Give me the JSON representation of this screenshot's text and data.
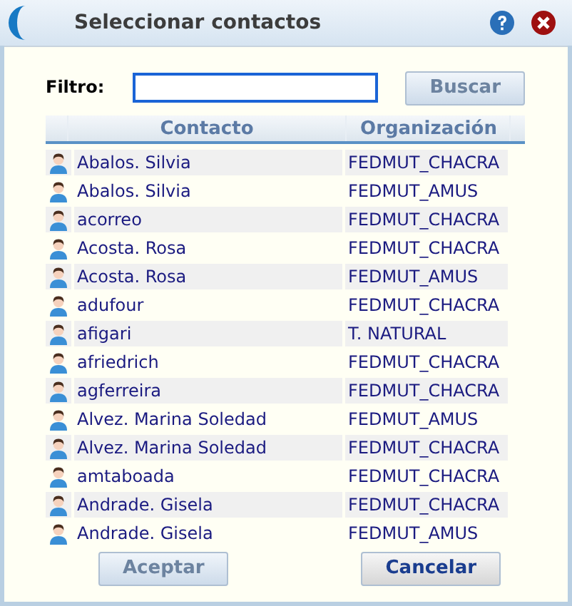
{
  "window": {
    "title": "Seleccionar contactos"
  },
  "filter": {
    "label": "Filtro:",
    "button": {
      "label": "Buscar",
      "disabled": true
    }
  },
  "table": {
    "columns": [
      "Contacto",
      "Organización"
    ],
    "rows": [
      {
        "contact": "Abalos. Silvia",
        "organization": "FEDMUT_CHACRA"
      },
      {
        "contact": "Abalos. Silvia",
        "organization": "FEDMUT_AMUS"
      },
      {
        "contact": "acorreo",
        "organization": "FEDMUT_CHACRA"
      },
      {
        "contact": "Acosta. Rosa",
        "organization": "FEDMUT_CHACRA"
      },
      {
        "contact": "Acosta. Rosa",
        "organization": "FEDMUT_AMUS"
      },
      {
        "contact": "adufour",
        "organization": "FEDMUT_CHACRA"
      },
      {
        "contact": "afigari",
        "organization": "T. NATURAL"
      },
      {
        "contact": "afriedrich",
        "organization": "FEDMUT_CHACRA"
      },
      {
        "contact": "agferreira",
        "organization": "FEDMUT_CHACRA"
      },
      {
        "contact": "Alvez. Marina Soledad",
        "organization": "FEDMUT_AMUS"
      },
      {
        "contact": "Alvez. Marina Soledad",
        "organization": "FEDMUT_CHACRA"
      },
      {
        "contact": "amtaboada",
        "organization": "FEDMUT_CHACRA"
      },
      {
        "contact": "Andrade. Gisela",
        "organization": "FEDMUT_CHACRA"
      },
      {
        "contact": "Andrade. Gisela",
        "organization": "FEDMUT_AMUS"
      }
    ]
  },
  "buttons": [
    {
      "label": "Aceptar",
      "disabled": true
    },
    {
      "label": "Cancelar",
      "disabled": false
    }
  ]
}
